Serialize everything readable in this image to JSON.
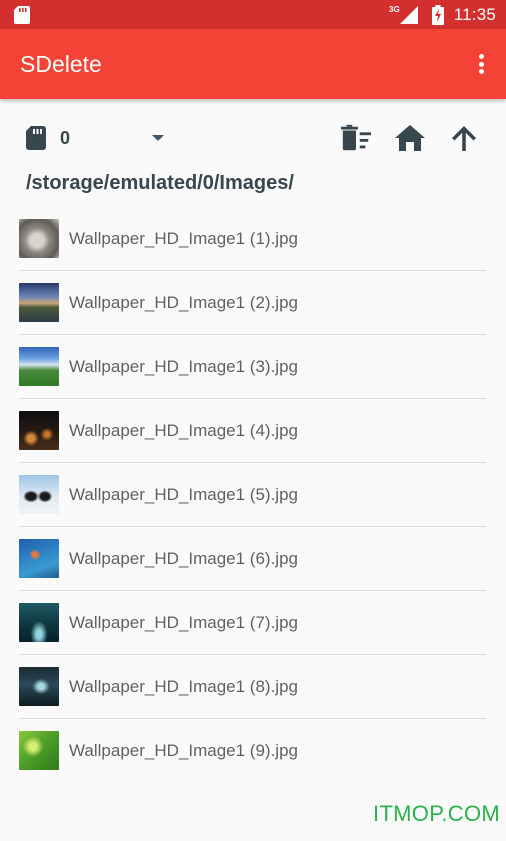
{
  "status_bar": {
    "time": "11:35",
    "network": "3G",
    "icons": [
      "sd-card-icon",
      "signal-icon",
      "battery-icon"
    ]
  },
  "app_bar": {
    "title": "SDelete",
    "menu_icon": "overflow-menu-icon"
  },
  "toolbar": {
    "sd_count": "0",
    "icons": [
      "sd-card-icon",
      "dropdown-arrow-icon",
      "delete-sweep-icon",
      "home-icon",
      "arrow-up-icon"
    ]
  },
  "path": "/storage/emulated/0/Images/",
  "files": [
    {
      "name": "Wallpaper_HD_Image1 (1).jpg"
    },
    {
      "name": "Wallpaper_HD_Image1 (2).jpg"
    },
    {
      "name": "Wallpaper_HD_Image1 (3).jpg"
    },
    {
      "name": "Wallpaper_HD_Image1 (4).jpg"
    },
    {
      "name": "Wallpaper_HD_Image1 (5).jpg"
    },
    {
      "name": "Wallpaper_HD_Image1 (6).jpg"
    },
    {
      "name": "Wallpaper_HD_Image1 (7).jpg"
    },
    {
      "name": "Wallpaper_HD_Image1 (8).jpg"
    },
    {
      "name": "Wallpaper_HD_Image1 (9).jpg"
    }
  ],
  "watermark": "ITMOP.COM",
  "colors": {
    "status_bar": "#d32f2f",
    "app_bar": "#f44336",
    "icon": "#37474f",
    "watermark": "#2bb24c"
  }
}
